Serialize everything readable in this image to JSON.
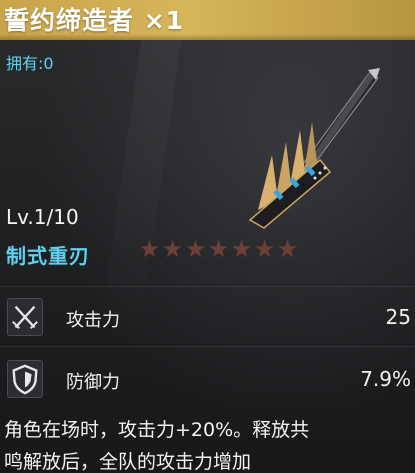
{
  "header": {
    "title": "誓约缔造者 ×1"
  },
  "owned_text": "拥有:0",
  "level_text": "Lv.1/10",
  "weapon_type": "制式重刃",
  "stars": {
    "total": 7,
    "filled": 0,
    "color": "#6e3f36"
  },
  "stats": [
    {
      "label": "攻击力",
      "value": "25",
      "icon": "sword-cross-icon"
    },
    {
      "label": "防御力",
      "value": "7.9%",
      "icon": "shield-icon"
    }
  ],
  "description": {
    "line1": "角色在场时，攻击力+20%。释放共",
    "line2": "鸣解放后，全队的攻击力增加"
  },
  "colors": {
    "header_gold": "#d7b55a",
    "accent_cyan": "#5fd0ee",
    "background": "#1f2022"
  }
}
